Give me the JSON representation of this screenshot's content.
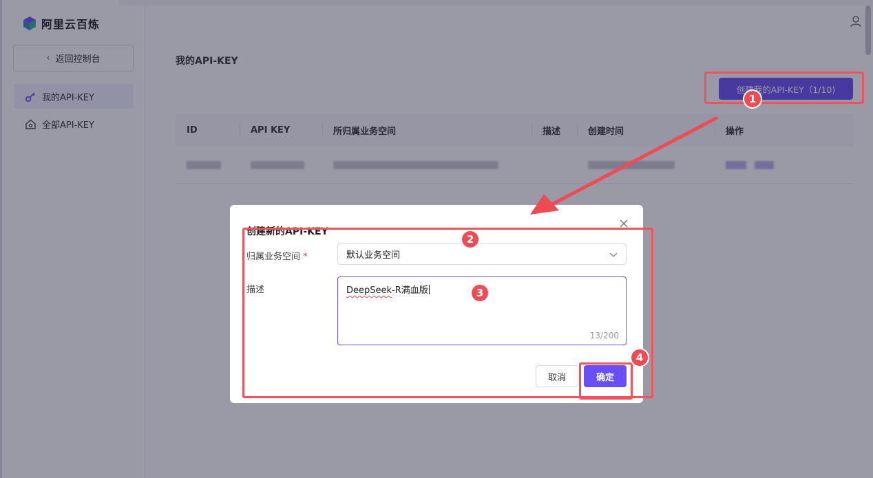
{
  "brand": {
    "name": "阿里云百炼"
  },
  "sidebar": {
    "back_label": "返回控制台",
    "items": [
      {
        "label": "我的API-KEY",
        "icon": "key-icon",
        "active": true
      },
      {
        "label": "全部API-KEY",
        "icon": "home-icon",
        "active": false
      }
    ]
  },
  "main": {
    "title": "我的API-KEY",
    "create_button": "创建我的API-KEY（1/10)",
    "table": {
      "columns": [
        "ID",
        "API KEY",
        "所归属业务空间",
        "描述",
        "创建时间",
        "操作"
      ]
    }
  },
  "modal": {
    "title": "创建新的API-KEY",
    "workspace_label": "归属业务空间",
    "required_mark": "*",
    "workspace_value": "默认业务空间",
    "desc_label": "描述",
    "desc_value_part1": "DeepSeek",
    "desc_value_part2": "-R满血版",
    "counter": "13/200",
    "cancel_label": "取消",
    "ok_label": "确定"
  },
  "annotations": {
    "badges": [
      "1",
      "2",
      "3",
      "4"
    ]
  },
  "colors": {
    "accent": "#6a4ff5",
    "annotation": "#f0525e",
    "overlay": "rgba(30,30,60,0.45)"
  }
}
